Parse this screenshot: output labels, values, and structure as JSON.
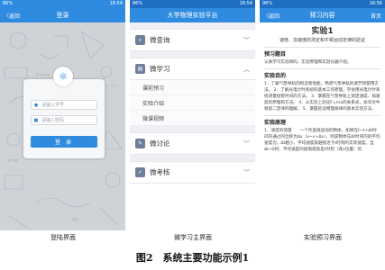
{
  "phones": {
    "login": {
      "status": {
        "left": "86%",
        "right": "16:54"
      },
      "nav": {
        "back": "〈返回",
        "title": "登录"
      },
      "username_placeholder": "请输入学号",
      "password_placeholder": "请输入密码",
      "login_button": "登 录"
    },
    "menu": {
      "status": {
        "left": "86%",
        "right": "16:54"
      },
      "nav": {
        "title": "大学物理实验平台"
      },
      "sections": [
        {
          "label": "微查询"
        },
        {
          "label": "微学习",
          "items": [
            "课前预习",
            "实验介绍",
            "微课视频"
          ]
        },
        {
          "label": "微讨论"
        },
        {
          "label": "微考核"
        }
      ]
    },
    "content": {
      "status": {
        "left": "96%",
        "right": "16:56"
      },
      "nav": {
        "back": "〈返回",
        "title": "预习内容",
        "home": "首页"
      },
      "title": "实验1",
      "subtitle": "速度、加速度的测定和牛顿运动定律的验证",
      "section1_heading": "预习题目",
      "section1_text": "认真学习实验目的、实验原理和实验仪器介绍。",
      "section2_heading": "实验目的",
      "section2_text": "1．了解气垫导轨的构造和性能，熟悉气垫导轨的调节和使用方法。 2．了解光电计时系统的基本工作原理，学会用光电计时系统测量短暂时间的方法。 3．掌握在气垫导轨上测定速度、加速度的原理和方法。 4．从实验上验证F=ma的关系式，加深对牛顿第二定律的理解。 5．掌握验证物理规律的基本实验方法。",
      "section3_heading": "实验原理",
      "section3_text": "1．速度的测量　　一个作直线运动的物体，如果在t~t+Δt时间内通过的位移为Δx（x~x+Δx），则该物体在Δt时间内的平均速度为，Δt越小，平均速度就越接近于t时刻的实际速度。当Δt→0时，平均速度的极限值就是t时刻（或x位置）的"
    }
  },
  "captions": [
    "登陆界面",
    "微学习主界面",
    "实验预习界面"
  ],
  "figure_caption": "图2　系统主要功能示例1"
}
